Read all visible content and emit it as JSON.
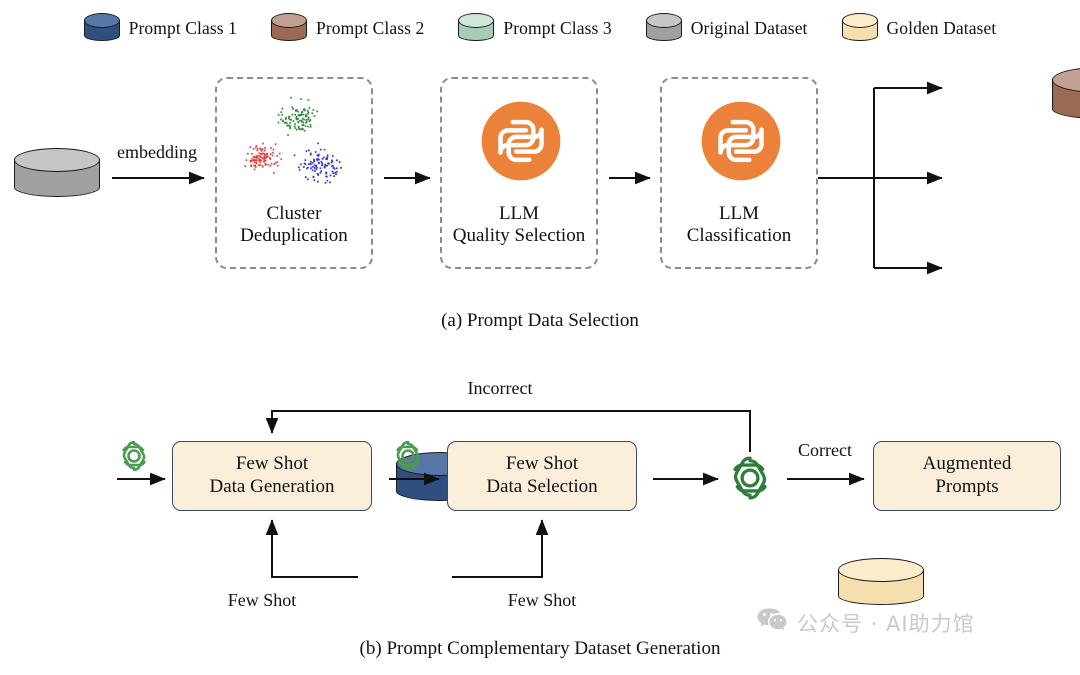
{
  "legend": {
    "items": [
      {
        "label": "Prompt Class 1",
        "color": "#2f4f80",
        "top_color": "#5877a8",
        "icon": "cylinder-icon"
      },
      {
        "label": "Prompt Class 2",
        "color": "#9c6a52",
        "top_color": "#c2a092",
        "icon": "cylinder-icon"
      },
      {
        "label": "Prompt Class 3",
        "color": "#a8cbb6",
        "top_color": "#cfe6d8",
        "icon": "cylinder-icon"
      },
      {
        "label": "Original Dataset",
        "color": "#a0a0a0",
        "top_color": "#c6c6c6",
        "icon": "cylinder-icon"
      },
      {
        "label": "Golden Dataset",
        "color": "#f6dfae",
        "top_color": "#fbeccb",
        "icon": "cylinder-icon"
      }
    ]
  },
  "panel_a": {
    "caption": "(a) Prompt Data Selection",
    "source_dataset": {
      "name": "original-dataset-cylinder",
      "color": "#a0a0a0",
      "top_color": "#c6c6c6"
    },
    "edge_label": "embedding",
    "stages": [
      {
        "id": "cluster-deduplication",
        "title_line1": "Cluster",
        "title_line2": "Deduplication",
        "icon": "scatter-cluster-icon",
        "clusters": [
          {
            "name": "cluster-green",
            "color": "#2d8a3e"
          },
          {
            "name": "cluster-red",
            "color": "#e04444"
          },
          {
            "name": "cluster-blue",
            "color": "#3434d8"
          }
        ]
      },
      {
        "id": "llm-quality-selection",
        "title_line1": "LLM",
        "title_line2": "Quality Selection",
        "icon": "llm-orange-icon",
        "icon_color": "#ec8239"
      },
      {
        "id": "llm-classification",
        "title_line1": "LLM",
        "title_line2": "Classification",
        "icon": "llm-orange-icon",
        "icon_color": "#ec8239"
      }
    ],
    "outputs": [
      {
        "name": "prompt-class-2-cylinder",
        "color": "#9c6a52",
        "top_color": "#c2a092"
      },
      {
        "name": "prompt-class-1-cylinder",
        "color": "#2f4f80",
        "top_color": "#5877a8"
      },
      {
        "name": "prompt-class-3-cylinder",
        "color": "#a8cbb6",
        "top_color": "#cfe6d8"
      }
    ]
  },
  "panel_b": {
    "caption": "(b) Prompt Complementary Dataset Generation",
    "input_dataset": {
      "name": "prompt-class-1-cylinder",
      "color": "#2f4f80",
      "top_color": "#5877a8"
    },
    "golden_dataset": {
      "name": "golden-dataset-cylinder",
      "color": "#f6dfae",
      "top_color": "#fbeccb"
    },
    "feedback_label": "Incorrect",
    "correct_label": "Correct",
    "few_shot_label_left": "Few Shot",
    "few_shot_label_right": "Few Shot",
    "boxes": [
      {
        "id": "few-shot-data-generation",
        "line1": "Few Shot",
        "line2": "Data Generation"
      },
      {
        "id": "few-shot-data-selection",
        "line1": "Few Shot",
        "line2": "Data Selection"
      },
      {
        "id": "augmented-prompts",
        "line1": "Augmented",
        "line2": "Prompts"
      }
    ],
    "gpt_icons": [
      {
        "name": "openai-icon",
        "color": "#4c9a53"
      },
      {
        "name": "openai-icon",
        "color": "#4c9a53"
      },
      {
        "name": "openai-icon",
        "color": "#2f7d3a"
      }
    ]
  },
  "watermark": {
    "icon": "wechat-icon",
    "text": "公众号 · AI助力馆",
    "color": "#c9c9c9"
  }
}
